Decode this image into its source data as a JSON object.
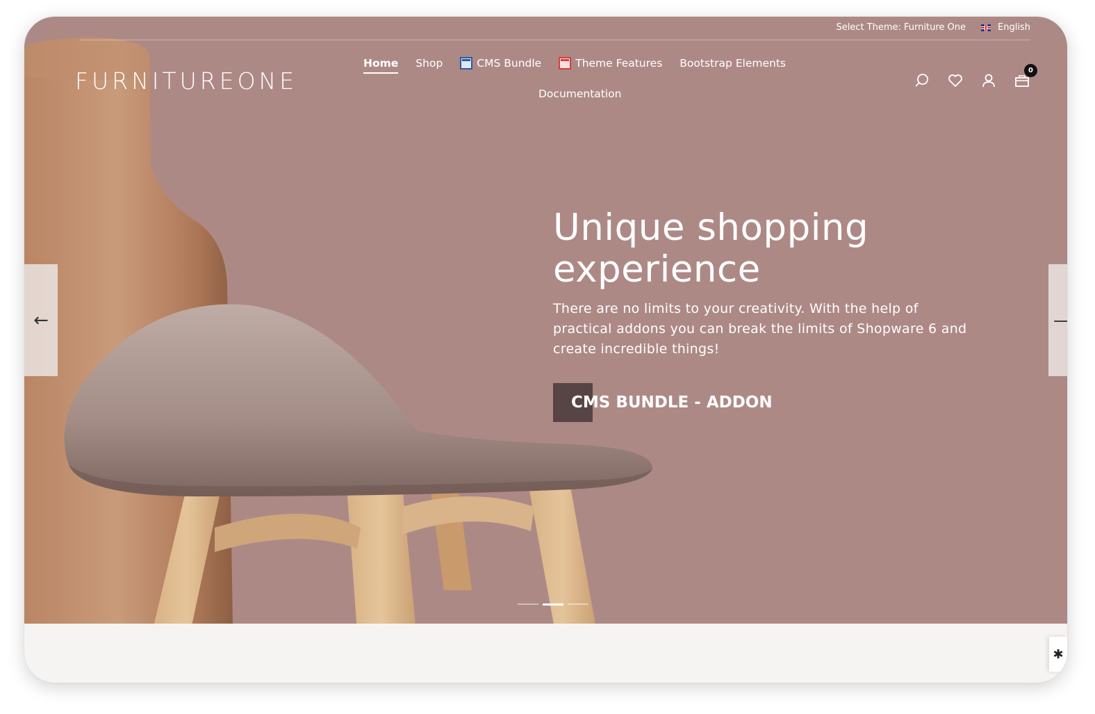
{
  "topbar": {
    "theme_select": "Select Theme: Furniture One",
    "language": "English"
  },
  "logo": "FURNITUREONE",
  "nav": {
    "items": [
      {
        "label": "Home",
        "active": true
      },
      {
        "label": "Shop"
      },
      {
        "label": "CMS Bundle",
        "icon": "cms-bundle-icon"
      },
      {
        "label": "Theme Features",
        "icon": "theme-features-icon"
      },
      {
        "label": "Bootstrap Elements"
      },
      {
        "label": "Documentation"
      }
    ]
  },
  "header_icons": {
    "search": "search-icon",
    "wishlist": "heart-icon",
    "account": "user-icon",
    "cart": "cart-icon",
    "cart_count": "0"
  },
  "hero": {
    "headline_line1": "Unique shopping",
    "headline_line2": "experience",
    "subtext": "There are no limits to your creativity. With the help of practical addons you can break the limits of Shopware 6 and create incredible things!",
    "cta_label": "CMS BUNDLE - ADDON",
    "background_color": "#ad8986",
    "slide_count": 3,
    "active_slide": 2
  },
  "colors": {
    "hero_bg": "#ad8986",
    "cta_block": "#574444",
    "footer_bg": "#f6f4f2"
  }
}
